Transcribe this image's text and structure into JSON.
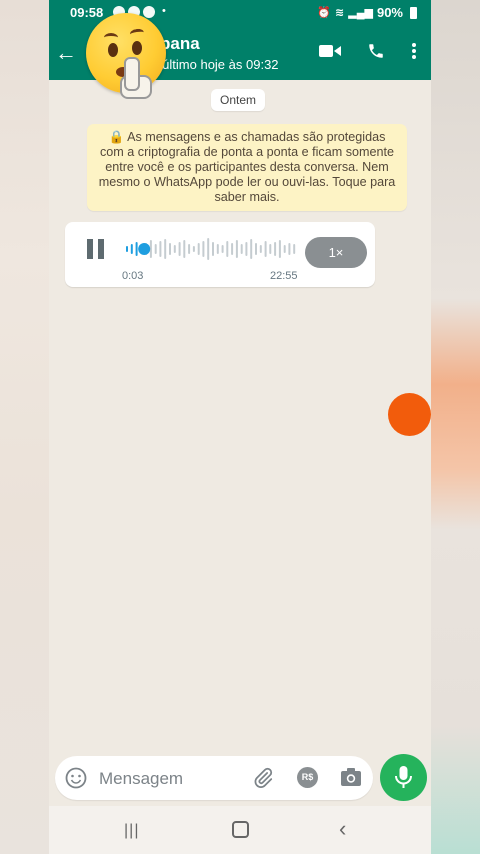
{
  "status_bar": {
    "time": "09:58",
    "battery": "90%"
  },
  "header": {
    "contact_name": "pana",
    "contact_status": "or último hoje às 09:32",
    "color": "#008069"
  },
  "chat": {
    "date_chip": "Ontem",
    "encryption_note": "As mensagens e as chamadas são protegidas com a criptografia de ponta a ponta e ficam somente entre você e os participantes desta conversa. Nem mesmo o WhatsApp pode ler ou ouvi-las. Toque para saber mais.",
    "voice_message": {
      "elapsed": "0:03",
      "timestamp": "22:55",
      "speed": "1×",
      "progress": 0.03
    }
  },
  "input": {
    "placeholder": "Mensagem",
    "pay_label": "R$"
  },
  "icons": {
    "back": "arrow-left-icon",
    "video": "video-call-icon",
    "call": "phone-icon",
    "menu": "more-vert-icon",
    "lock": "lock-icon",
    "emoji": "emoji-icon",
    "attach": "paperclip-icon",
    "camera": "camera-icon",
    "mic": "mic-icon"
  },
  "colors": {
    "accent": "#008069",
    "mic_button": "#25b35c",
    "waveform_played": "#1e9ee0",
    "overlay_dot": "#f25c0c"
  }
}
